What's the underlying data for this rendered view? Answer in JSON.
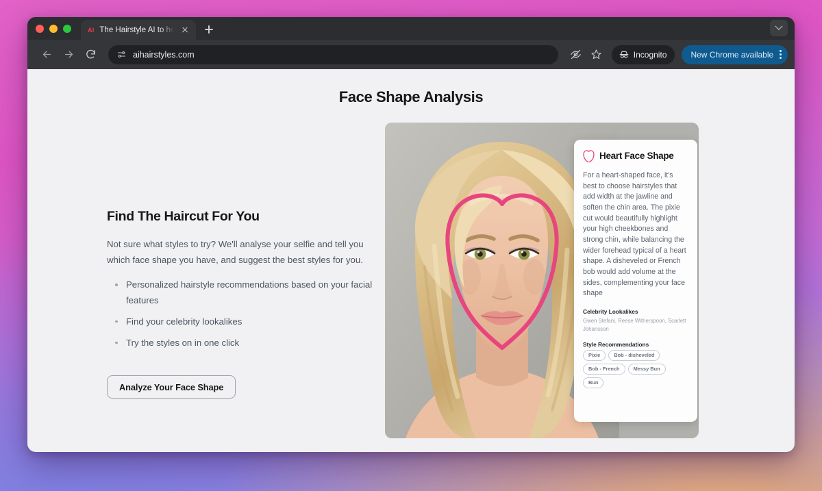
{
  "browser": {
    "tab": {
      "favicon_text": "AI",
      "title": "The Hairstyle AI to help you fi"
    },
    "new_tab_label": "+",
    "url": "aihairstyles.com",
    "incognito_label": "Incognito",
    "update_label": "New Chrome available"
  },
  "page": {
    "title": "Face Shape Analysis",
    "hero": {
      "headline": "Find The Haircut For You",
      "lede": "Not sure what styles to try? We'll analyse your selfie and tell you which face shape you have, and suggest the best styles for you.",
      "bullets": [
        "Personalized hairstyle recommendations based on your facial features",
        "Find your celebrity lookalikes",
        "Try the styles on in one click"
      ],
      "cta_label": "Analyze Your Face Shape"
    },
    "result_card": {
      "shape_title": "Heart Face Shape",
      "description": "For a heart-shaped face, it's best to choose hairstyles that add width at the jawline and soften the chin area. The pixie cut would beautifully highlight your high cheekbones and strong chin, while balancing the wider forehead typical of a heart shape. A disheveled or French bob would add volume at the sides, complementing your face shape",
      "lookalikes_title": "Celebrity Lookalikes",
      "lookalikes": "Gwen Stefani, Reese Witherspoon, Scarlett Johansson",
      "styles_title": "Style Recommendations",
      "styles": [
        "Pixie",
        "Bob - disheveled",
        "Bob - French",
        "Messy Bun",
        "Bun"
      ]
    },
    "colors": {
      "accent_pink": "#e8457e",
      "update_blue": "#0f5a8f",
      "page_bg": "#f1f1f3"
    }
  }
}
